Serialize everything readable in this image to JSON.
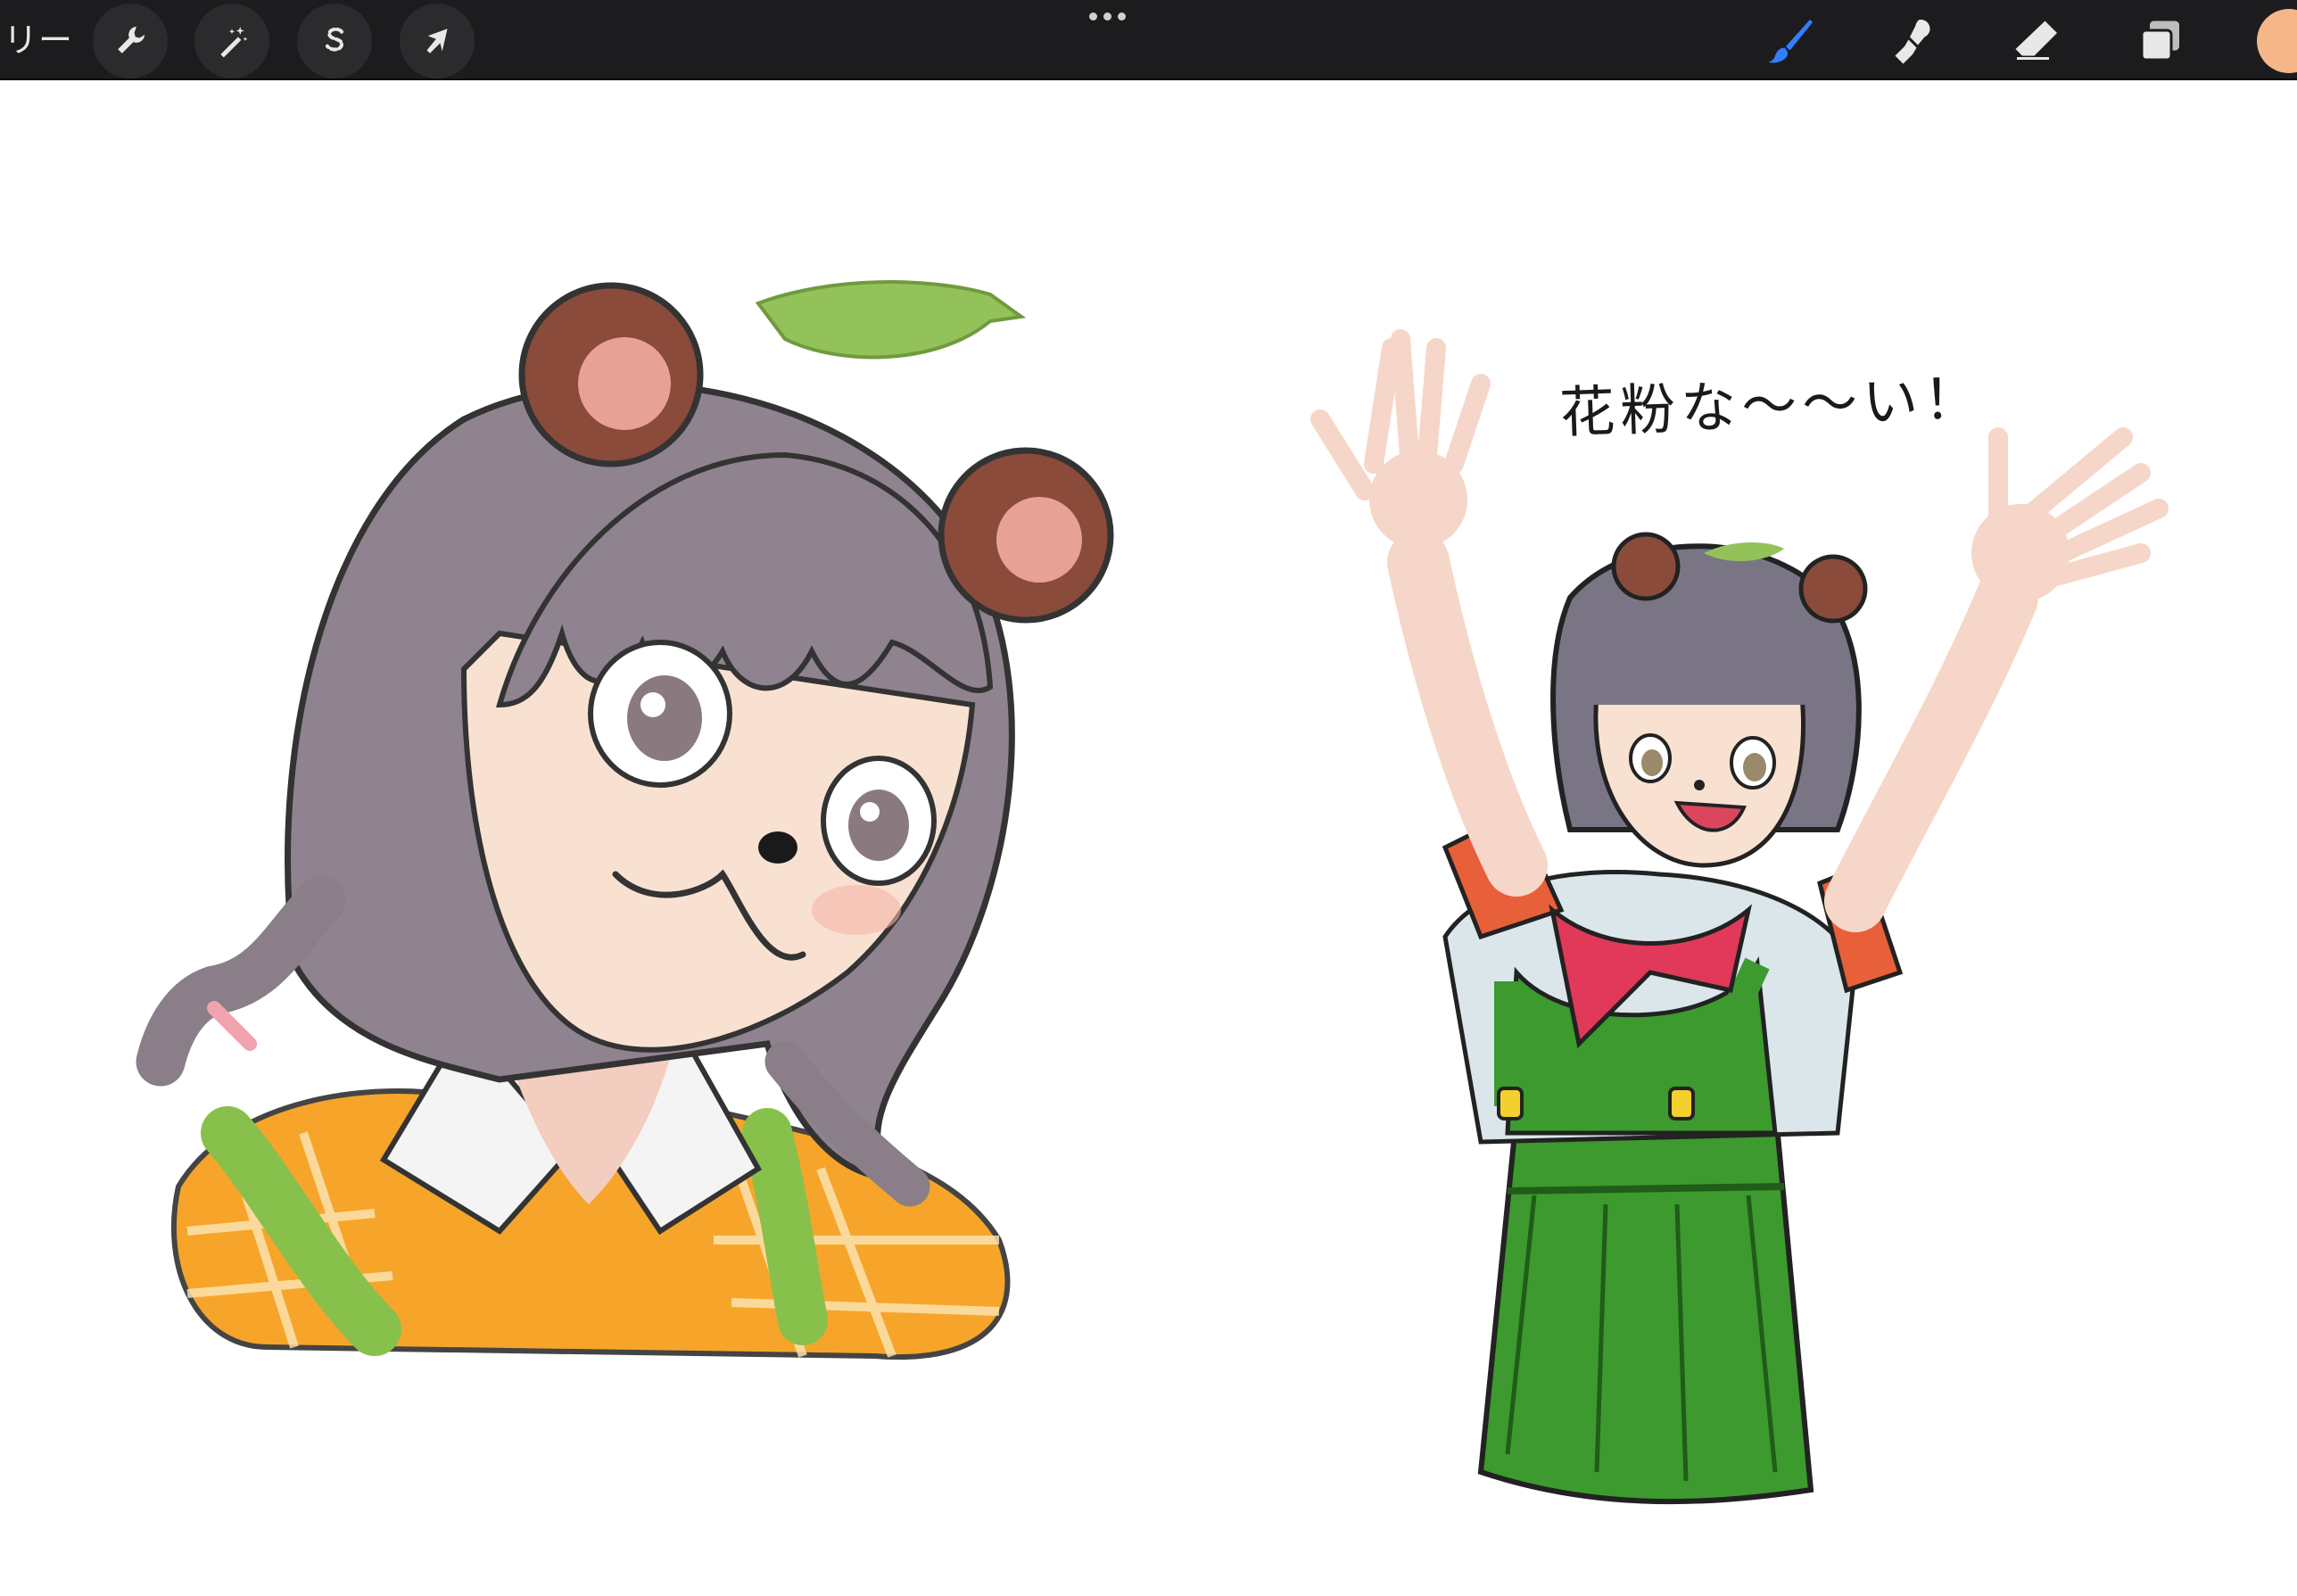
{
  "toolbar": {
    "gallery_label": "リー",
    "left_tools": [
      {
        "name": "actions",
        "icon": "wrench-icon"
      },
      {
        "name": "adjustments",
        "icon": "magic-wand-icon"
      },
      {
        "name": "selection",
        "icon": "selection-s-icon"
      },
      {
        "name": "transform",
        "icon": "arrow-cursor-icon"
      }
    ],
    "more_icon": "more-dots-icon",
    "right_tools": [
      {
        "name": "brush",
        "icon": "brush-icon",
        "active": true
      },
      {
        "name": "smudge",
        "icon": "smudge-icon",
        "active": false
      },
      {
        "name": "eraser",
        "icon": "eraser-icon",
        "active": false
      },
      {
        "name": "layers",
        "icon": "layers-icon",
        "active": false
      }
    ],
    "current_color": "#f5b78a",
    "active_color": "#2f7fff"
  },
  "canvas": {
    "caption": "花粉な〜〜い！",
    "palette": {
      "hair": "#8f8390",
      "skin": "#f9e1d2",
      "ear": "#8a4b3a",
      "leaf": "#93c25a",
      "orange": "#f6a52a",
      "green": "#3d9a2e",
      "red_scarf": "#e0395a",
      "shirt_sleeve": "#e8603a"
    }
  }
}
